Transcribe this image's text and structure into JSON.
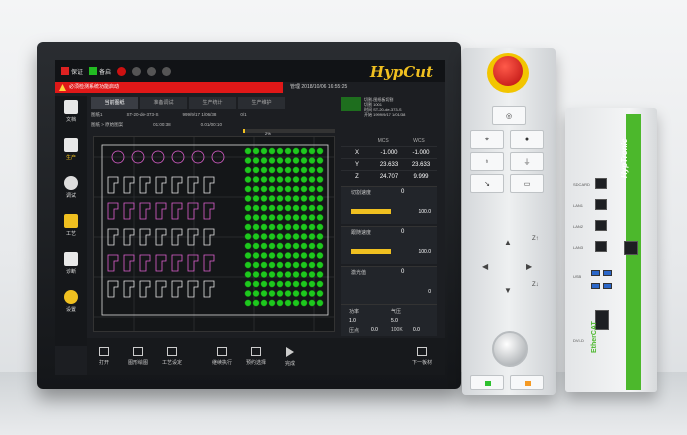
{
  "toolbar": {
    "save_label": "保证",
    "flash_label": "备启"
  },
  "brand": {
    "logo": "HypCut",
    "ipc_brand": "HypTronic",
    "ipc_logo": "EtherCAT"
  },
  "alarm": {
    "text": "必须检测系统功能启动"
  },
  "status": {
    "info": "管理 2018/10/06 16:55:25"
  },
  "sidebar": {
    "items": [
      {
        "label": "文档",
        "icon": "document-icon"
      },
      {
        "label": "生产",
        "icon": "cut-icon"
      },
      {
        "label": "调试",
        "icon": "gauge-icon"
      },
      {
        "label": "工艺",
        "icon": "folder-icon"
      },
      {
        "label": "诊断",
        "icon": "chart-icon"
      },
      {
        "label": "设置",
        "icon": "gear-icon"
      }
    ]
  },
  "tabs": [
    "当前图纸",
    "准备调试",
    "生产统计",
    "生产维护"
  ],
  "toolrow": {
    "a": "图纸1",
    "b": "ST-20-de-373-S",
    "c": "999/9/17 1/06/38",
    "d": "0/1"
  },
  "toolrow2": {
    "a": "图纸 > 原始图案",
    "b": "01:00:38",
    "c": "0.01/00:10"
  },
  "progress": {
    "value": 0.02,
    "label": "2%"
  },
  "preview": {
    "line1": "切割-图纸板切割",
    "line2": "切割  1001",
    "line3": "时间  ST-20-de-373-S",
    "line4": "开始  1999/9/17 1/01/38"
  },
  "coords": {
    "headers": [
      "",
      "MCS",
      "WCS"
    ],
    "rows": [
      {
        "axis": "X",
        "mcs": "-1.000",
        "wcs": "-1.000"
      },
      {
        "axis": "Y",
        "mcs": "23.633",
        "wcs": "23.633"
      },
      {
        "axis": "Z",
        "mcs": "24.707",
        "wcs": "9.999"
      }
    ]
  },
  "params": [
    {
      "title": "切割速度",
      "value": "0",
      "num": "100.0"
    },
    {
      "title": "跟随速度",
      "value": "0",
      "num": "100.0"
    },
    {
      "title": "激光值",
      "value": "0",
      "num": "0"
    }
  ],
  "gas": {
    "pressure_label": "功率",
    "pressure": "1.0",
    "gas_label": "气压",
    "gas": "5.0",
    "p_label": "压点",
    "p": "0.0",
    "x_label": "100K",
    "x": "0.0"
  },
  "bottombar": [
    "打开",
    "图形绘图",
    "工艺设定",
    "继续执行",
    "预约选择",
    "完成",
    "下一板材"
  ],
  "canvas_label": "0%",
  "pendant": {
    "keys": [
      "",
      "",
      "",
      "",
      "",
      "",
      "",
      ""
    ],
    "dpad": [
      "Z↑",
      "Z↓"
    ]
  },
  "ipc": {
    "labels": [
      "SDCARD",
      "LAN1",
      "LAN2",
      "LAN3",
      "USB",
      "DVI-D"
    ]
  }
}
